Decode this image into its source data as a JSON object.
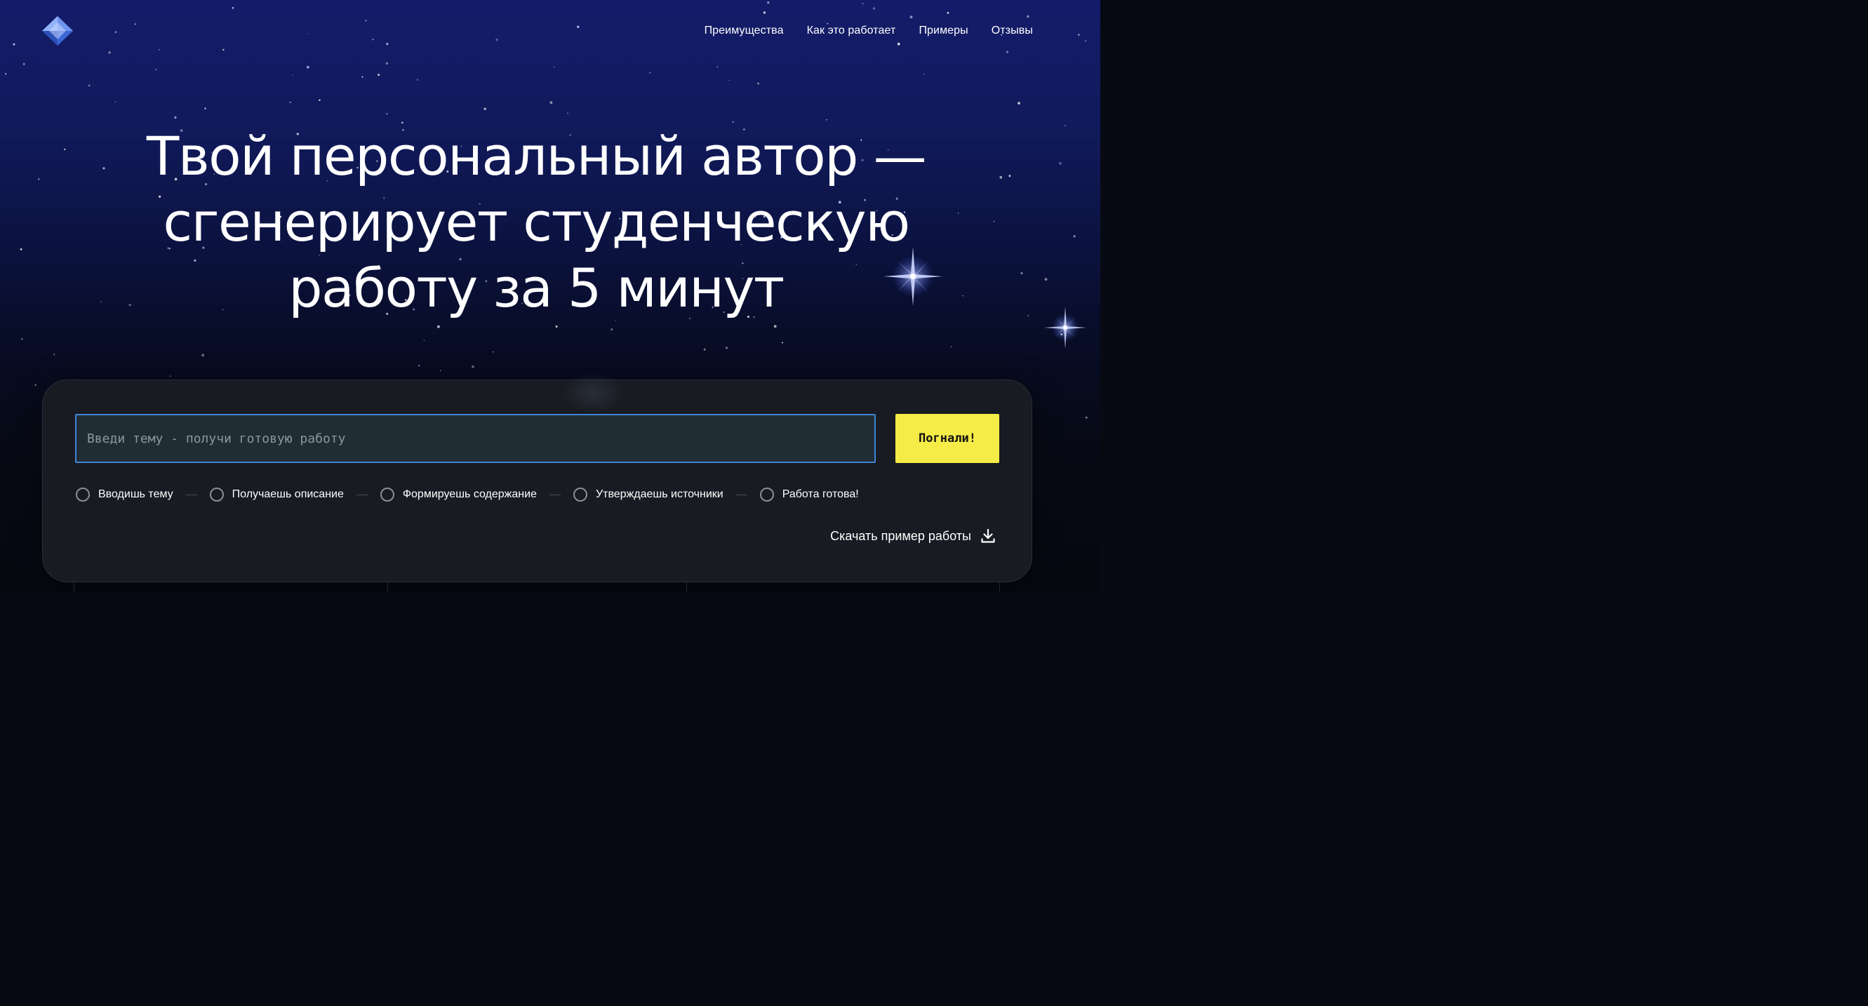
{
  "nav": {
    "items": [
      {
        "label": "Преимущества"
      },
      {
        "label": "Как это работает"
      },
      {
        "label": "Примеры"
      },
      {
        "label": "Отзывы"
      }
    ]
  },
  "hero": {
    "lines": [
      "Твой персональный автор —",
      "сгенерирует студенческую",
      "работу за 5 минут"
    ]
  },
  "form": {
    "input_value": "",
    "input_placeholder": "Введи тему - получи готовую работу",
    "submit_label": "Погнали!"
  },
  "steps": [
    {
      "label": "Вводишь тему"
    },
    {
      "label": "Получаешь описание"
    },
    {
      "label": "Формируешь содержание"
    },
    {
      "label": "Утверждаешь источники"
    },
    {
      "label": "Работа готова!"
    }
  ],
  "download": {
    "label": "Скачать пример работы",
    "icon": "download-icon"
  },
  "logo": {
    "icon": "diamond-logo-icon"
  },
  "colors": {
    "accent_yellow": "#f6ec48",
    "input_border": "#3f86d6",
    "card_bg": "#181b21",
    "sky_top": "#141c6a"
  }
}
